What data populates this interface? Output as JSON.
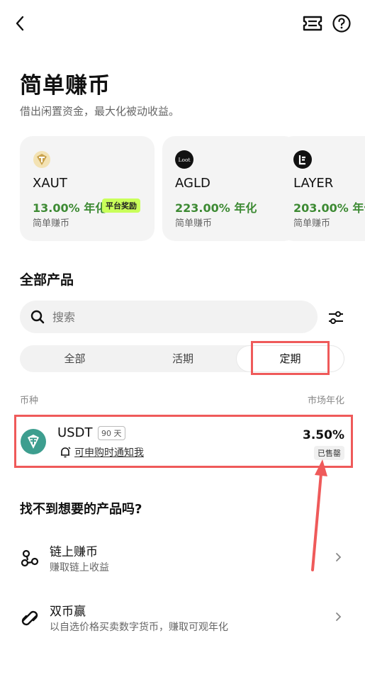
{
  "header": {
    "title": "简单赚币",
    "subtitle": "借出闲置资金，最大化被动收益。"
  },
  "featured": [
    {
      "symbol": "XAUT",
      "rate": "13.00% 年化",
      "badge": "平台奖励",
      "category": "简单赚币",
      "icon_color": "#c9a24d",
      "icon": "tether-gold-icon"
    },
    {
      "symbol": "AGLD",
      "rate": "223.00% 年化",
      "category": "简单赚币",
      "icon_color": "#111111",
      "icon_text": "Loot",
      "icon": "loot-icon"
    },
    {
      "symbol": "LAYER",
      "rate": "203.00% 年化",
      "category": "简单赚币",
      "icon_color": "#111111",
      "icon": "layer-icon"
    }
  ],
  "products": {
    "section_title": "全部产品",
    "search_placeholder": "搜索",
    "tabs": [
      "全部",
      "活期",
      "定期"
    ],
    "active_tab": "定期",
    "col_currency": "币种",
    "col_apr": "市场年化",
    "rows": [
      {
        "name": "USDT",
        "term": "90 天",
        "notify": "可申购时通知我",
        "apr": "3.50%",
        "status": "已售罄"
      }
    ]
  },
  "more": {
    "title": "找不到想要的产品吗?",
    "items": [
      {
        "title": "链上赚币",
        "desc": "赚取链上收益"
      },
      {
        "title": "双币赢",
        "desc": "以自选价格买卖数字货币，赚取可观年化"
      }
    ]
  },
  "colors": {
    "green": "#3d8a33",
    "reward_badge": "#c9ff5a",
    "highlight": "#ef5a5a",
    "usdt": "#3d9e8f"
  }
}
